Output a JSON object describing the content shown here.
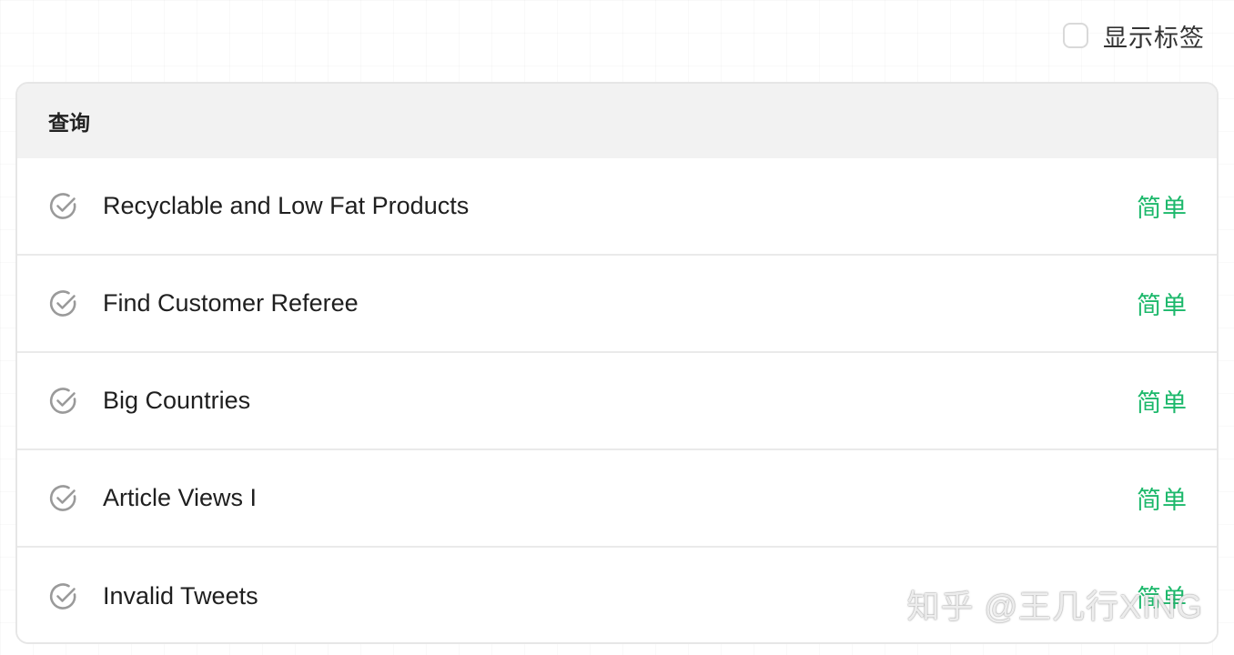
{
  "toolbar": {
    "show_tags_label": "显示标签",
    "show_tags_checked": false
  },
  "card": {
    "title": "查询"
  },
  "problems": [
    {
      "title": "Recyclable and Low Fat Products",
      "difficulty": "简单",
      "status_icon": "check-circle-icon"
    },
    {
      "title": "Find Customer Referee",
      "difficulty": "简单",
      "status_icon": "check-circle-icon"
    },
    {
      "title": "Big Countries",
      "difficulty": "简单",
      "status_icon": "check-circle-icon"
    },
    {
      "title": "Article Views I",
      "difficulty": "简单",
      "status_icon": "check-circle-icon"
    },
    {
      "title": "Invalid Tweets",
      "difficulty": "简单",
      "status_icon": "check-circle-icon"
    }
  ],
  "watermark": "知乎 @王几行XING",
  "colors": {
    "easy": "#1cb86b",
    "icon": "#9a9a9a",
    "header_bg": "#f2f2f2",
    "border": "#e6e6e6"
  }
}
